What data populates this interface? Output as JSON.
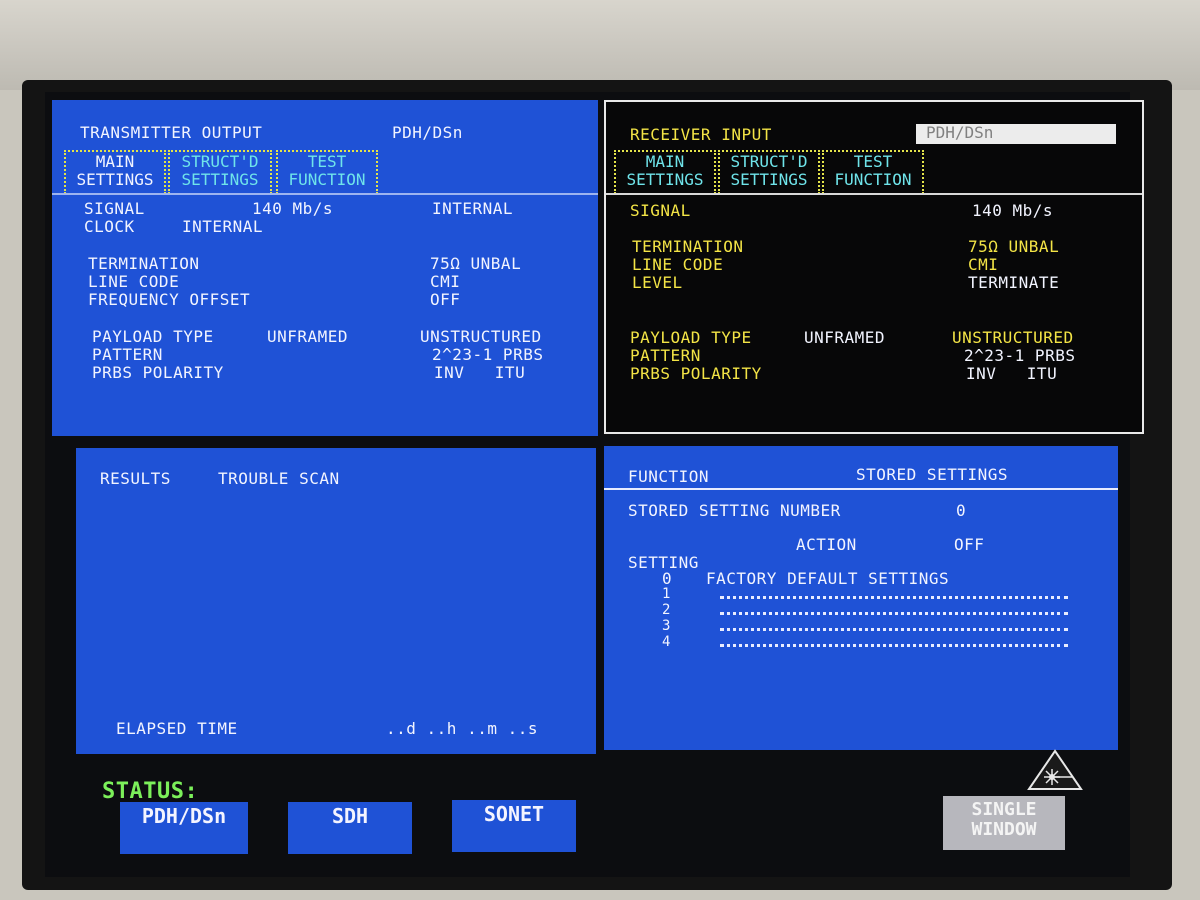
{
  "transmitter": {
    "title": "TRANSMITTER OUTPUT",
    "mode": "PDH/DSn",
    "tabs": [
      {
        "line1": "MAIN",
        "line2": "SETTINGS"
      },
      {
        "line1": "STRUCT'D",
        "line2": "SETTINGS"
      },
      {
        "line1": "TEST",
        "line2": "FUNCTION"
      }
    ],
    "signal_label": "SIGNAL",
    "signal_rate": "140 Mb/s",
    "signal_source": "INTERNAL",
    "clock_label": "CLOCK",
    "clock_value": "INTERNAL",
    "termination_label": "TERMINATION",
    "termination_value": "75Ω UNBAL",
    "line_code_label": "LINE CODE",
    "line_code_value": "CMI",
    "freq_offset_label": "FREQUENCY OFFSET",
    "freq_offset_value": "OFF",
    "payload_label": "PAYLOAD TYPE",
    "payload_framing": "UNFRAMED",
    "payload_structure": "UNSTRUCTURED",
    "pattern_label": "PATTERN",
    "pattern_value": "2^23-1 PRBS",
    "polarity_label": "PRBS POLARITY",
    "polarity_value": "INV   ITU"
  },
  "receiver": {
    "title": "RECEIVER INPUT",
    "mode": "PDH/DSn",
    "tabs": [
      {
        "line1": "MAIN",
        "line2": "SETTINGS"
      },
      {
        "line1": "STRUCT'D",
        "line2": "SETTINGS"
      },
      {
        "line1": "TEST",
        "line2": "FUNCTION"
      }
    ],
    "signal_label": "SIGNAL",
    "signal_rate": "140 Mb/s",
    "termination_label": "TERMINATION",
    "termination_value": "75Ω UNBAL",
    "line_code_label": "LINE CODE",
    "line_code_value": "CMI",
    "level_label": "LEVEL",
    "level_value": "TERMINATE",
    "payload_label": "PAYLOAD TYPE",
    "payload_framing": "UNFRAMED",
    "payload_structure": "UNSTRUCTURED",
    "pattern_label": "PATTERN",
    "pattern_value": "2^23-1 PRBS",
    "polarity_label": "PRBS POLARITY",
    "polarity_value": "INV   ITU"
  },
  "results": {
    "title": "RESULTS",
    "view": "TROUBLE SCAN",
    "elapsed_label": "ELAPSED TIME",
    "elapsed_value": "..d ..h ..m ..s"
  },
  "function": {
    "title": "FUNCTION",
    "name": "STORED SETTINGS",
    "number_label": "STORED SETTING NUMBER",
    "number_value": "0",
    "action_label": "ACTION",
    "action_value": "OFF",
    "setting_header": "SETTING",
    "settings": [
      {
        "num": "0",
        "name": "FACTORY DEFAULT SETTINGS"
      },
      {
        "num": "1",
        "name": ""
      },
      {
        "num": "2",
        "name": ""
      },
      {
        "num": "3",
        "name": ""
      },
      {
        "num": "4",
        "name": ""
      }
    ]
  },
  "status": {
    "label": "STATUS:",
    "softkeys": [
      "PDH/DSn",
      "SDH",
      "SONET"
    ],
    "window_key_line1": "SINGLE",
    "window_key_line2": "WINDOW"
  },
  "colors": {
    "panel_blue": "#1f52d6",
    "label_yellow": "#f3e446",
    "tab_cyan": "#6fe4ea",
    "status_green": "#7cf05a"
  },
  "icons": {
    "laser_warning": "laser-warning-icon"
  }
}
